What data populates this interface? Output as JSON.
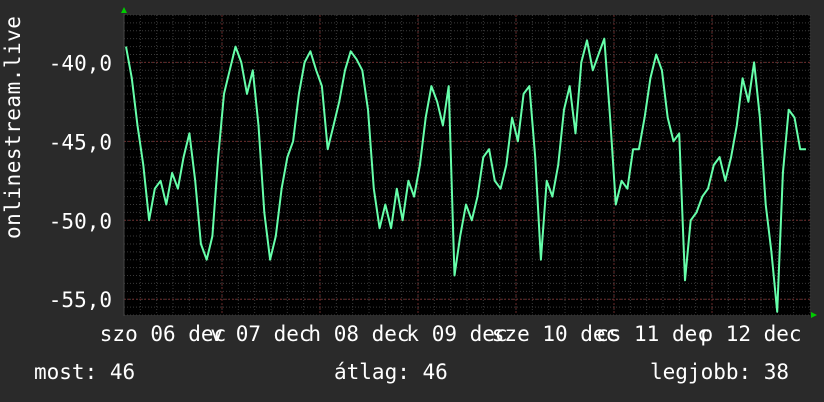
{
  "chart_data": {
    "type": "line",
    "ylabel": "onlinestream.live",
    "ylim": [
      -56,
      -37
    ],
    "yticks": [
      -40,
      -45,
      -50,
      -55
    ],
    "ytick_labels": [
      "-40,0",
      "-45,0",
      "-50,0",
      "-55,0"
    ],
    "x_ticks": [
      "szo 06 dec",
      "v 07 dec",
      "h 08 dec",
      "k 09 dec",
      "sze 10 dec",
      "cs 11 dec",
      "p 12 dec"
    ],
    "grid": true,
    "colors": {
      "background": "#2a2a2a",
      "plot": "#000000",
      "line": "#66ffaa",
      "grid_major": "#6a2a2a",
      "grid_minor": "#3a3a3a",
      "arrow": "#00cc00"
    },
    "series": [
      {
        "values": [
          -39.0,
          -41.0,
          -44.0,
          -46.5,
          -50.0,
          -48.0,
          -47.5,
          -49.0,
          -47.0,
          -48.0,
          -46.0,
          -44.5,
          -47.5,
          -51.5,
          -52.5,
          -51.0,
          -46.0,
          -42.0,
          -40.5,
          -39.0,
          -40.0,
          -42.0,
          -40.5,
          -44.0,
          -49.5,
          -52.5,
          -51.0,
          -48.0,
          -46.0,
          -45.0,
          -42.0,
          -40.0,
          -39.3,
          -40.5,
          -41.5,
          -45.5,
          -44.0,
          -42.5,
          -40.5,
          -39.3,
          -39.8,
          -40.5,
          -43.0,
          -48.0,
          -50.5,
          -49.0,
          -50.5,
          -48.0,
          -50.0,
          -47.5,
          -48.5,
          -46.5,
          -43.5,
          -41.5,
          -42.5,
          -44.0,
          -41.5,
          -53.5,
          -51.0,
          -49.0,
          -50.0,
          -48.5,
          -46.0,
          -45.5,
          -47.5,
          -48.0,
          -46.5,
          -43.5,
          -45.0,
          -42.0,
          -41.5,
          -46.0,
          -52.5,
          -47.5,
          -48.5,
          -46.5,
          -43.0,
          -41.5,
          -44.5,
          -40.0,
          -38.6,
          -40.5,
          -39.5,
          -38.5,
          -43.5,
          -49.0,
          -47.5,
          -48.0,
          -45.5,
          -45.5,
          -43.5,
          -41.0,
          -39.5,
          -40.5,
          -43.5,
          -45.0,
          -44.5,
          -53.8,
          -50.0,
          -49.5,
          -48.5,
          -48.0,
          -46.5,
          -46.0,
          -47.5,
          -46.0,
          -44.0,
          -41.0,
          -42.5,
          -40.0,
          -43.5,
          -49.0,
          -52.0,
          -55.8,
          -47.0,
          -43.0,
          -43.5,
          -45.5,
          -45.5
        ]
      }
    ]
  },
  "footer": {
    "now": "most: 46",
    "avg": "átlag: 46",
    "best": "legjobb: 38"
  }
}
